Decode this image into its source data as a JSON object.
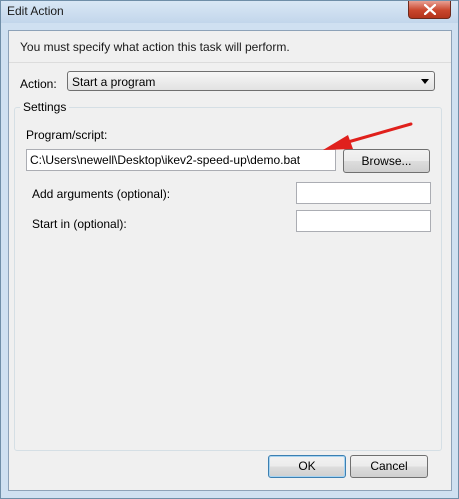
{
  "window": {
    "title": "Edit Action"
  },
  "dialog": {
    "instruction": "You must specify what action this task will perform.",
    "action_label": "Action:",
    "action_value": "Start a program",
    "settings_legend": "Settings",
    "program_label": "Program/script:",
    "program_value": "C:\\Users\\newell\\Desktop\\ikev2-speed-up\\demo.bat",
    "browse_label": "Browse...",
    "args_label": "Add arguments (optional):",
    "args_value": "",
    "start_label": "Start in (optional):",
    "start_value": "",
    "ok_label": "OK",
    "cancel_label": "Cancel"
  },
  "icons": {
    "close": "close-icon",
    "dropdown": "chevron-down-icon",
    "annotation": "red-arrow-annotation"
  },
  "colors": {
    "window_frame": "#cfe0f1",
    "client_bg": "#f0f0f0",
    "close_button": "#c9462c",
    "annotation_arrow": "#e0201c"
  }
}
